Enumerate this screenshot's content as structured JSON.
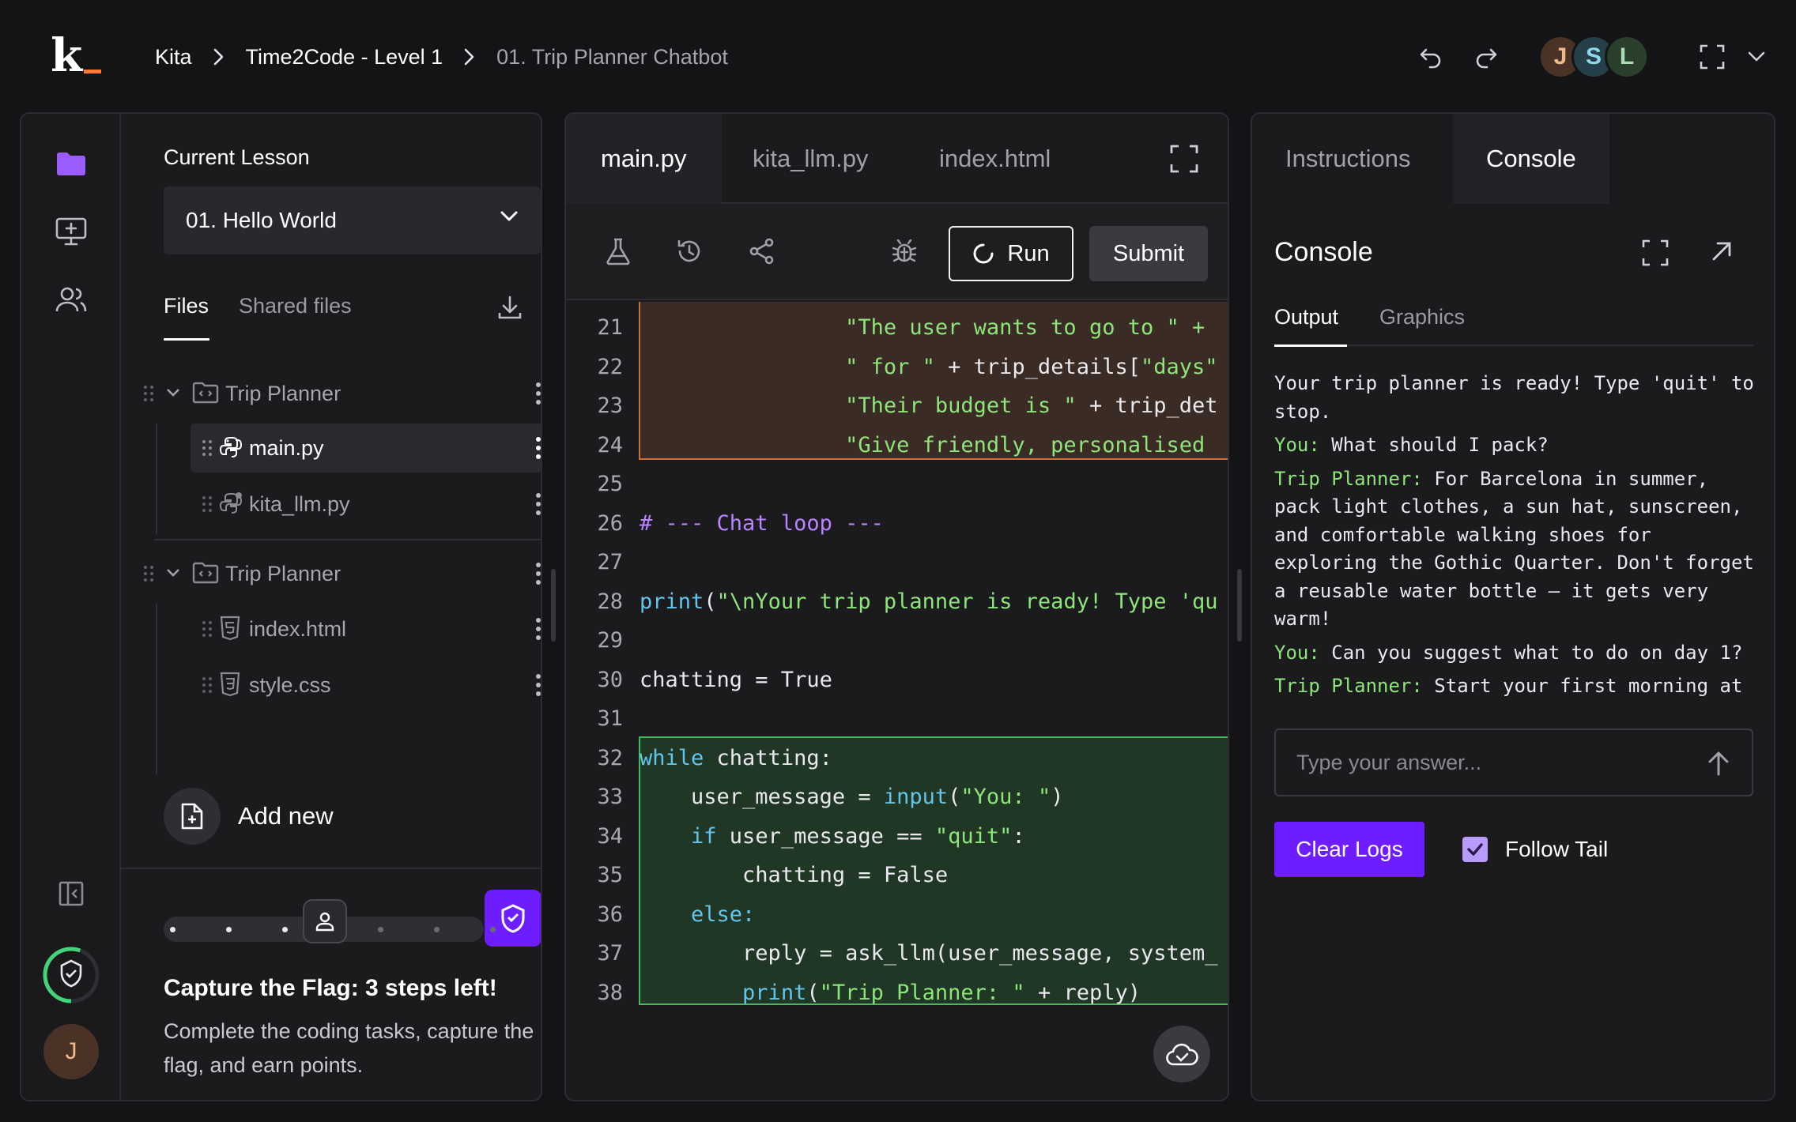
{
  "breadcrumb": [
    "Kita",
    "Time2Code - Level 1",
    "01. Trip Planner Chatbot"
  ],
  "logo": {
    "letter": "k"
  },
  "avatars": [
    {
      "initial": "J",
      "bg": "#4a3326",
      "fg": "#f0b98a"
    },
    {
      "initial": "S",
      "bg": "#26404a",
      "fg": "#8fd8f0"
    },
    {
      "initial": "L",
      "bg": "#2a3f2c",
      "fg": "#a9dcae"
    }
  ],
  "sidebar": {
    "current_lesson_label": "Current Lesson",
    "lesson_selected": "01. Hello World",
    "tabs": {
      "files": "Files",
      "shared": "Shared files"
    },
    "tree": [
      {
        "type": "folder",
        "name": "Trip Planner"
      },
      {
        "type": "file",
        "name": "main.py",
        "icon": "python-icon",
        "selected": true
      },
      {
        "type": "file",
        "name": "kita_llm.py",
        "icon": "python-icon"
      },
      {
        "type": "folder",
        "name": "Trip Planner"
      },
      {
        "type": "file",
        "name": "index.html",
        "icon": "html5-icon"
      },
      {
        "type": "file",
        "name": "style.css",
        "icon": "css3-icon"
      }
    ],
    "add_new": "Add new",
    "ctf": {
      "title": "Capture the Flag: 3 steps left!",
      "description": "Complete the coding tasks, capture the flag, and earn points.",
      "steps_total": 7,
      "steps_done": 3
    },
    "user_initial": "J"
  },
  "editor": {
    "tabs": [
      "main.py",
      "kita_llm.py",
      "index.html"
    ],
    "active_tab": "main.py",
    "run_label": "Run",
    "submit_label": "Submit",
    "lines": [
      {
        "n": "21",
        "tokens": [
          [
            "",
            "                "
          ],
          [
            "s",
            "\"The user wants to go to \" + "
          ]
        ]
      },
      {
        "n": "22",
        "tokens": [
          [
            "",
            "                "
          ],
          [
            "s",
            "\" for \""
          ],
          [
            "",
            " + trip_details["
          ],
          [
            "s",
            "\"days\""
          ]
        ]
      },
      {
        "n": "23",
        "tokens": [
          [
            "",
            "                "
          ],
          [
            "s",
            "\"Their budget is \""
          ],
          [
            "",
            " + trip_det"
          ]
        ]
      },
      {
        "n": "24",
        "tokens": [
          [
            "",
            "                "
          ],
          [
            "s",
            "\"Give friendly, personalised "
          ]
        ]
      },
      {
        "n": "25",
        "tokens": []
      },
      {
        "n": "26",
        "tokens": [
          [
            "cm",
            "# --- Chat loop ---"
          ]
        ]
      },
      {
        "n": "27",
        "tokens": []
      },
      {
        "n": "28",
        "tokens": [
          [
            "kw",
            "print"
          ],
          [
            "",
            "("
          ],
          [
            "s",
            "\"\\nYour trip planner is ready! Type 'qu"
          ]
        ]
      },
      {
        "n": "29",
        "tokens": []
      },
      {
        "n": "30",
        "tokens": [
          [
            "",
            "chatting = True"
          ]
        ]
      },
      {
        "n": "31",
        "tokens": []
      },
      {
        "n": "32",
        "tokens": [
          [
            "kw",
            "while"
          ],
          [
            "",
            " chatting:"
          ]
        ]
      },
      {
        "n": "33",
        "tokens": [
          [
            "",
            "    user_message = "
          ],
          [
            "kw",
            "input"
          ],
          [
            "",
            "("
          ],
          [
            "s",
            "\"You: \""
          ],
          [
            "",
            ")"
          ]
        ]
      },
      {
        "n": "34",
        "tokens": [
          [
            "",
            "    "
          ],
          [
            "kw",
            "if"
          ],
          [
            "",
            " user_message == "
          ],
          [
            "s",
            "\"quit\""
          ],
          [
            "",
            ":"
          ]
        ]
      },
      {
        "n": "35",
        "tokens": [
          [
            "",
            "        chatting = False"
          ]
        ]
      },
      {
        "n": "36",
        "tokens": [
          [
            "",
            "    "
          ],
          [
            "kw",
            "else:"
          ]
        ]
      },
      {
        "n": "37",
        "tokens": [
          [
            "",
            "        reply = ask_llm(user_message, system_"
          ]
        ]
      },
      {
        "n": "38",
        "tokens": [
          [
            "",
            "        "
          ],
          [
            "kw",
            "print"
          ],
          [
            "",
            "("
          ],
          [
            "s",
            "\"Trip Planner: \""
          ],
          [
            "",
            " + reply)"
          ]
        ]
      }
    ]
  },
  "right_panel": {
    "tabs": [
      "Instructions",
      "Console"
    ],
    "active_tab": "Console",
    "console_title": "Console",
    "output_tabs": [
      "Output",
      "Graphics"
    ],
    "log": [
      {
        "speaker": "",
        "text": "Your trip planner is ready! Type 'quit' to stop."
      },
      {
        "speaker": "You:",
        "text": "What should I pack?"
      },
      {
        "speaker": "Trip Planner:",
        "text": "For Barcelona in summer, pack light clothes, a sun hat, sunscreen, and comfortable walking shoes for exploring the Gothic Quarter. Don't forget a reusable water bottle – it gets very warm!"
      },
      {
        "speaker": "You:",
        "text": "Can you suggest what to do on day 1?"
      },
      {
        "speaker": "Trip Planner:",
        "text": "Start your first morning at the Sagrada Família before the crowds arrive, then head to the Barceloneta beach for the afternoon. In the evening, try some tapas on Carrer del Parlament – very popular with locals and great for your budget!"
      }
    ],
    "answer_placeholder": "Type your answer...",
    "clear_label": "Clear Logs",
    "follow_label": "Follow Tail",
    "follow_checked": true
  },
  "colors": {
    "accent": "#6d1dff",
    "string": "#8ee57a",
    "keyword": "#63c5ea",
    "comment": "#b884ff",
    "error_highlight": "#c87037",
    "ok_highlight": "#49b760"
  }
}
